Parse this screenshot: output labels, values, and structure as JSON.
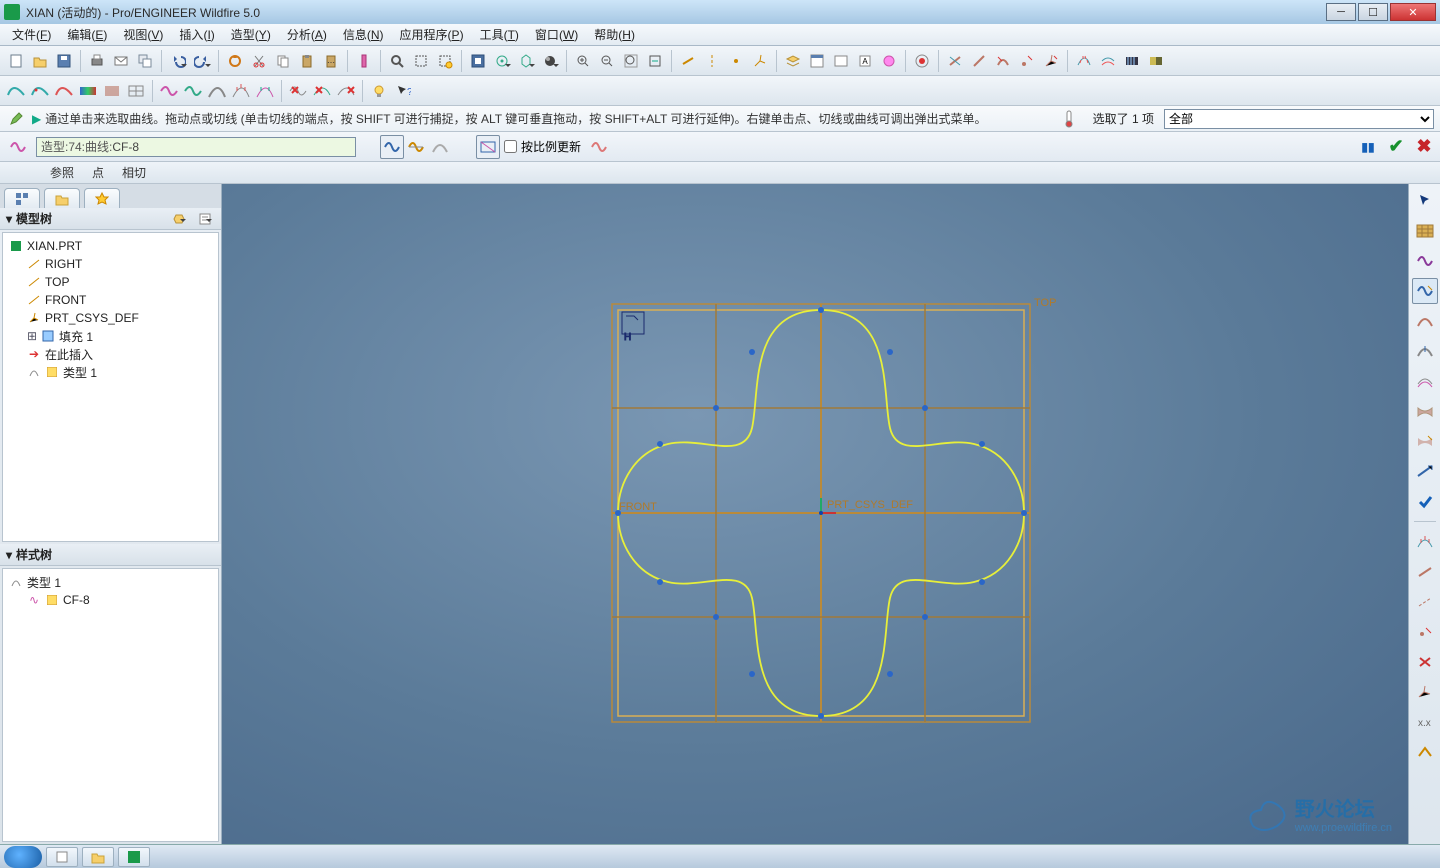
{
  "title": "XIAN (活动的) - Pro/ENGINEER Wildfire 5.0",
  "menu": [
    {
      "label": "文件",
      "m": "F"
    },
    {
      "label": "编辑",
      "m": "E"
    },
    {
      "label": "视图",
      "m": "V"
    },
    {
      "label": "插入",
      "m": "I"
    },
    {
      "label": "造型",
      "m": "Y"
    },
    {
      "label": "分析",
      "m": "A"
    },
    {
      "label": "信息",
      "m": "N"
    },
    {
      "label": "应用程序",
      "m": "P"
    },
    {
      "label": "工具",
      "m": "T"
    },
    {
      "label": "窗口",
      "m": "W"
    },
    {
      "label": "帮助",
      "m": "H"
    }
  ],
  "hint": "通过单击来选取曲线。拖动点或切线 (单击切线的端点，按 SHIFT 可进行捕捉，按 ALT 键可垂直拖动，按 SHIFT+ALT 可进行延伸)。右键单击点、切线或曲线可调出弹出式菜单。",
  "selection": {
    "label": "选取了",
    "count": "1",
    "unit": "项"
  },
  "filter_option": "全部",
  "dashboard": {
    "curve_icon": "~",
    "field_prefix": "造型:74:曲线:",
    "field_value": "CF-8",
    "update_label": "按比例更新"
  },
  "slide_tabs": [
    "参照",
    "点",
    "相切"
  ],
  "model_tree_title": "模型树",
  "model_tree": {
    "root": "XIAN.PRT",
    "datum": [
      "RIGHT",
      "TOP",
      "FRONT"
    ],
    "csys": "PRT_CSYS_DEF",
    "fill": "填充 1",
    "insert": "在此插入",
    "feature": "类型 1"
  },
  "style_tree_title": "样式树",
  "style_tree": {
    "root": "类型 1",
    "curve": "CF-8"
  },
  "viewport_labels": {
    "top": "TOP",
    "front": "FRONT",
    "csys": "PRT_CSYS_DEF"
  },
  "watermark": {
    "main": "野火论坛",
    "sub": "www.proewildfire.cn"
  }
}
